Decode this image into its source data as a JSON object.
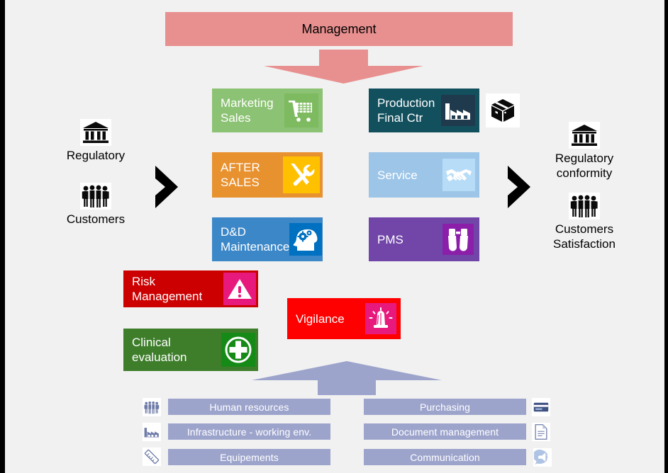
{
  "diagram": {
    "title": "Management",
    "banner": {
      "label": "Management",
      "color": "#E8908F"
    },
    "arrows": {
      "down_color": "#E8908F",
      "up_color": "#9DA4CC",
      "chevron_color": "#000000"
    },
    "core_processes": [
      {
        "key": "marketing-sales",
        "label": "Marketing\nSales",
        "box_color": "#8CC273",
        "icon_bg": "#7DBA60",
        "icon": "shopping-cart-icon"
      },
      {
        "key": "after-sales",
        "label": "AFTER\nSALES",
        "box_color": "#E8912F",
        "icon_bg": "#FFC000",
        "icon": "tools-icon"
      },
      {
        "key": "dd-maintenance",
        "label": "D&D\nMaintenance",
        "box_color": "#3C87C8",
        "icon_bg": "#0070C0",
        "icon": "head-gears-icon"
      },
      {
        "key": "production-final-ctr",
        "label": "Production\nFinal Ctr",
        "box_color": "#13505E",
        "icon_bg": "#1F3A4D",
        "icon": "factory-icon"
      },
      {
        "key": "service",
        "label": "Service",
        "box_color": "#9CC5E8",
        "icon_bg": "#B7DCF7",
        "icon": "handshake-icon"
      },
      {
        "key": "pms",
        "label": "PMS",
        "box_color": "#7146A8",
        "icon_bg": "#8B1FA9",
        "icon": "binoculars-icon"
      }
    ],
    "transversal_processes": [
      {
        "key": "risk-management",
        "label": "Risk\nManagement",
        "box_color": "#CC0000",
        "icon_bg": "#E8197D",
        "icon": "warning-triangle-icon"
      },
      {
        "key": "clinical-evaluation",
        "label": "Clinical\nevaluation",
        "box_color": "#3E7E2B",
        "icon_bg": "#168A16",
        "icon": "medical-cross-icon"
      },
      {
        "key": "vigilance",
        "label": "Vigilance",
        "box_color": "#FF0000",
        "icon_bg": "#E8197D",
        "icon": "alarm-light-icon"
      }
    ],
    "inputs": [
      {
        "key": "regulatory",
        "label": "Regulatory",
        "icon": "bank-icon"
      },
      {
        "key": "customers",
        "label": "Customers",
        "icon": "people-group-icon"
      }
    ],
    "outputs": [
      {
        "key": "regulatory-conformity",
        "label": "Regulatory\nconformity",
        "icon": "bank-icon"
      },
      {
        "key": "customers-satisfaction",
        "label": "Customers\nSatisfaction",
        "icon": "people-group-icon"
      }
    ],
    "support_processes": {
      "bar_color": "#9DA4CC",
      "left": [
        {
          "key": "human-resources",
          "label": "Human resources",
          "icon": "people-group-icon"
        },
        {
          "key": "infrastructure",
          "label": "Infrastructure - working env.",
          "icon": "factory-icon"
        },
        {
          "key": "equipements",
          "label": "Equipements",
          "icon": "ruler-icon"
        }
      ],
      "right": [
        {
          "key": "purchasing",
          "label": "Purchasing",
          "icon": "credit-card-icon"
        },
        {
          "key": "document-management",
          "label": "Document management",
          "icon": "document-icon"
        },
        {
          "key": "communication",
          "label": "Communication",
          "icon": "megaphone-bubble-icon"
        }
      ]
    }
  }
}
